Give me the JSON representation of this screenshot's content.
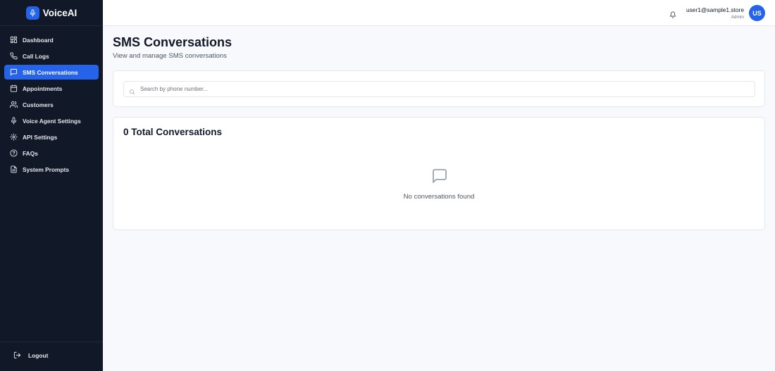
{
  "brand": {
    "name": "VoiceAI",
    "logo_icon": "microphone-icon"
  },
  "sidebar": {
    "items": [
      {
        "label": "Dashboard",
        "icon": "dashboard-icon",
        "active": false
      },
      {
        "label": "Call Logs",
        "icon": "phone-icon",
        "active": false
      },
      {
        "label": "SMS Conversations",
        "icon": "message-icon",
        "active": true
      },
      {
        "label": "Appointments",
        "icon": "calendar-icon",
        "active": false
      },
      {
        "label": "Customers",
        "icon": "users-icon",
        "active": false
      },
      {
        "label": "Voice Agent Settings",
        "icon": "microphone-icon",
        "active": false
      },
      {
        "label": "API Settings",
        "icon": "gear-icon",
        "active": false
      },
      {
        "label": "FAQs",
        "icon": "help-circle-icon",
        "active": false
      },
      {
        "label": "System Prompts",
        "icon": "file-text-icon",
        "active": false
      }
    ],
    "logout_label": "Logout"
  },
  "header": {
    "user_email": "user1@sample1.store",
    "user_role": "Admin",
    "avatar_initials": "US"
  },
  "page": {
    "title": "SMS Conversations",
    "subtitle": "View and manage SMS conversations"
  },
  "search": {
    "placeholder": "Search by phone number...",
    "value": ""
  },
  "conversations": {
    "heading": "0 Total Conversations",
    "empty_message": "No conversations found"
  },
  "colors": {
    "sidebar_bg": "#111827",
    "accent": "#2563eb",
    "page_bg": "#f8f9fc"
  }
}
